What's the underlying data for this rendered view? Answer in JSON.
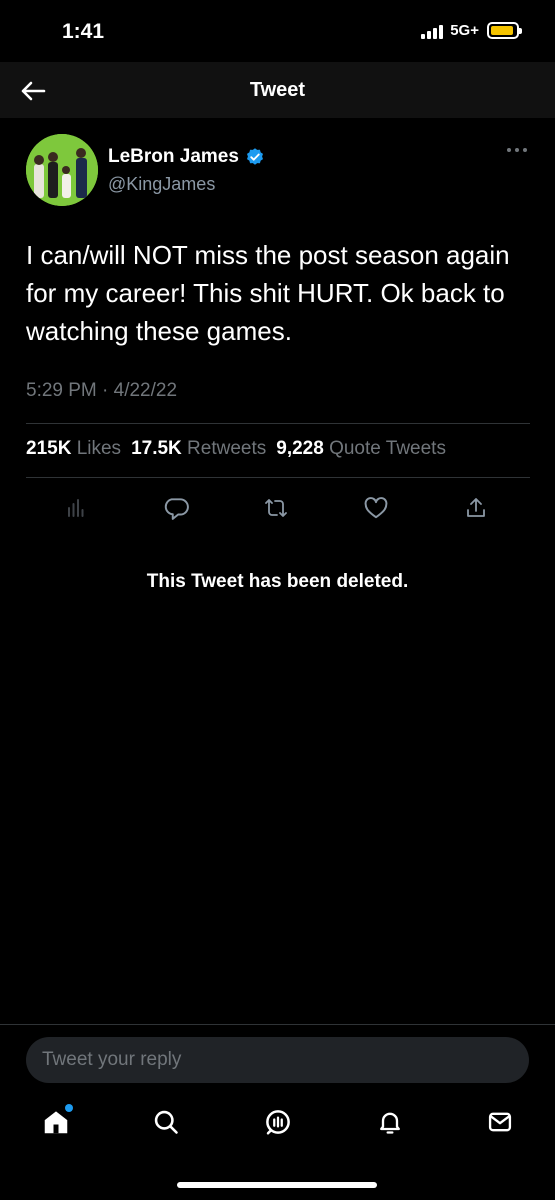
{
  "status_bar": {
    "time": "1:41",
    "network": "5G+"
  },
  "header": {
    "title": "Tweet"
  },
  "tweet": {
    "author_name": "LeBron James",
    "author_handle": "@KingJames",
    "verified": true,
    "text": "I can/will NOT miss the post season again for my career! This shit HURT. Ok back to watching these games.",
    "timestamp": "5:29 PM · 4/22/22",
    "stats": {
      "likes_count": "215K",
      "likes_label": "Likes",
      "retweets_count": "17.5K",
      "retweets_label": "Retweets",
      "quotes_count": "9,228",
      "quotes_label": "Quote Tweets"
    },
    "actions": [
      "analytics-icon",
      "reply-icon",
      "retweet-icon",
      "like-icon",
      "share-icon"
    ]
  },
  "deleted_notice": "This Tweet has been deleted.",
  "reply": {
    "placeholder": "Tweet your reply"
  },
  "tabbar": {
    "tabs": [
      "home-icon",
      "search-icon",
      "spaces-icon",
      "notifications-icon",
      "messages-icon"
    ],
    "home_has_notification": true
  },
  "colors": {
    "background": "#000000",
    "accent": "#1d9bf0",
    "muted": "#71767b",
    "battery": "#f5c400"
  }
}
